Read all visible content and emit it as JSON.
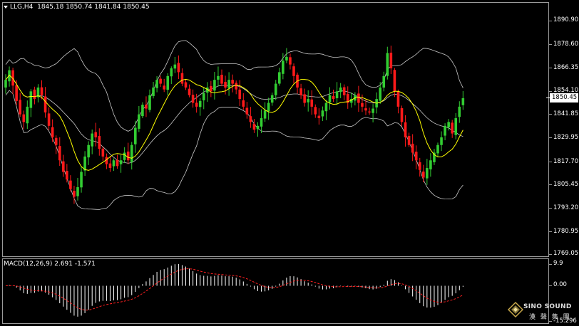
{
  "header": {
    "symbol": "LLG,H4",
    "open": "1845.18",
    "high": "1850.74",
    "low": "1841.84",
    "close": "1850.45"
  },
  "price_axis": {
    "labels": [
      "1890.90",
      "1878.60",
      "1866.35",
      "1854.10",
      "1841.85",
      "1829.95",
      "1817.70",
      "1805.45",
      "1793.20",
      "1780.95",
      "1769.05"
    ],
    "current_price": "1850.45"
  },
  "macd": {
    "title": "MACD(12,26,9)",
    "main": "2.691",
    "signal": "-1.571",
    "axis_labels": [
      "9.9",
      "0.00",
      "-15.296"
    ]
  },
  "logo": {
    "name": "SINO SOUND",
    "chinese": "漢 聲 集 團"
  },
  "colors": {
    "background": "#000000",
    "bull_candle": "#32cd32",
    "bear_candle": "#ff1a1a",
    "bollinger": "#c8c8c8",
    "moving_average": "#ffff00",
    "macd_hist": "#ffffff",
    "macd_signal": "#ff2020"
  },
  "chart_data": {
    "type": "candlestick",
    "symbol": "LLG",
    "timeframe": "H4",
    "ylim": [
      1769.05,
      1896.0
    ],
    "close": [
      1860,
      1865,
      1857,
      1849,
      1842,
      1838,
      1846,
      1854,
      1850,
      1856,
      1852,
      1843,
      1836,
      1830,
      1826,
      1818,
      1812,
      1808,
      1803,
      1799,
      1804,
      1812,
      1820,
      1826,
      1832,
      1830,
      1824,
      1820,
      1816,
      1814,
      1818,
      1815,
      1818,
      1822,
      1818,
      1826,
      1835,
      1842,
      1847,
      1845,
      1852,
      1856,
      1860,
      1858,
      1855,
      1862,
      1866,
      1868,
      1864,
      1858,
      1856,
      1852,
      1848,
      1846,
      1849,
      1853,
      1856,
      1854,
      1860,
      1862,
      1858,
      1856,
      1860,
      1858,
      1855,
      1850,
      1846,
      1842,
      1838,
      1834,
      1836,
      1840,
      1844,
      1848,
      1852,
      1858,
      1864,
      1870,
      1872,
      1868,
      1862,
      1856,
      1852,
      1848,
      1850,
      1846,
      1842,
      1840,
      1844,
      1848,
      1852,
      1850,
      1854,
      1856,
      1852,
      1848,
      1850,
      1852,
      1848,
      1846,
      1844,
      1843,
      1845,
      1850,
      1856,
      1862,
      1874,
      1866,
      1854,
      1846,
      1838,
      1830,
      1826,
      1822,
      1818,
      1813,
      1809,
      1814,
      1818,
      1822,
      1826,
      1830,
      1836,
      1838,
      1832,
      1840,
      1846,
      1850.45
    ],
    "bollinger_period": 20,
    "ma_period": 10,
    "macd_params": [
      12,
      26,
      9
    ]
  }
}
